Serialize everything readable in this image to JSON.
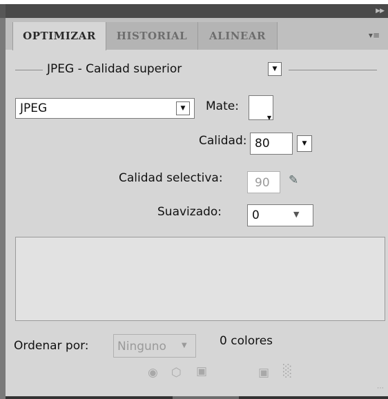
{
  "header": {
    "collapse_icon": "double-chevron-right"
  },
  "tabs": [
    {
      "label": "OPTIMIZAR",
      "active": true
    },
    {
      "label": "HISTORIAL",
      "active": false
    },
    {
      "label": "ALINEAR",
      "active": false
    }
  ],
  "panel_menu_icon": "panel-menu",
  "preset": {
    "value": "JPEG - Calidad superior"
  },
  "format": {
    "value": "JPEG"
  },
  "mate": {
    "label": "Mate:"
  },
  "calidad": {
    "label": "Calidad:",
    "value": "80"
  },
  "calidad_selectiva": {
    "label": "Calidad selectiva:",
    "value": "90"
  },
  "suavizado": {
    "label": "Suavizado:",
    "value": "0"
  },
  "ordenar": {
    "label": "Ordenar por:",
    "value": "Ninguno",
    "count": "0 colores"
  },
  "bottom_icons": [
    "web-snap-icon",
    "lock-cube-icon",
    "lock-icon",
    "new-swatch-icon",
    "trash-icon"
  ],
  "colors": {
    "panel_bg": "#d6d6d6",
    "tab_strip": "#bfbfbf",
    "frame": "#575757"
  }
}
